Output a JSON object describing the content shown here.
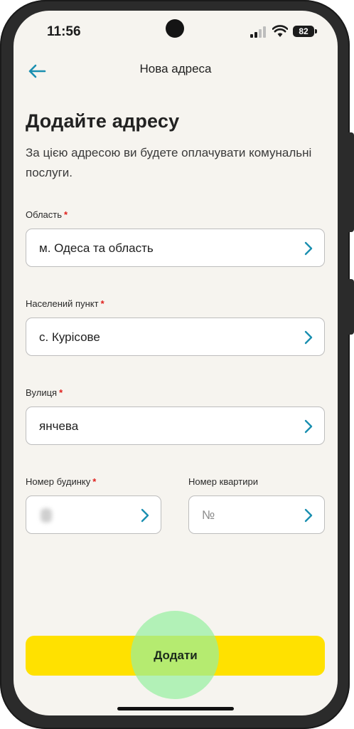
{
  "status_bar": {
    "time": "11:56",
    "battery": "82"
  },
  "header": {
    "title": "Нова адреса"
  },
  "intro": {
    "heading": "Додайте адресу",
    "description": "За цією адресою ви будете оплачувати комунальні послуги."
  },
  "form": {
    "required_mark": "*",
    "region": {
      "label": "Область",
      "value": "м. Одеса та область"
    },
    "locality": {
      "label": "Населений пункт",
      "value": "с. Курісове"
    },
    "street": {
      "label": "Вулиця",
      "value": "янчева"
    },
    "house": {
      "label": "Номер будинку",
      "value": ""
    },
    "apartment": {
      "label": "Номер квартири",
      "placeholder": "№"
    }
  },
  "actions": {
    "add_label": "Додати"
  },
  "colors": {
    "accent": "#1a8fb0",
    "button": "#ffe100",
    "required": "#e0201d",
    "background": "#f6f4ef"
  }
}
